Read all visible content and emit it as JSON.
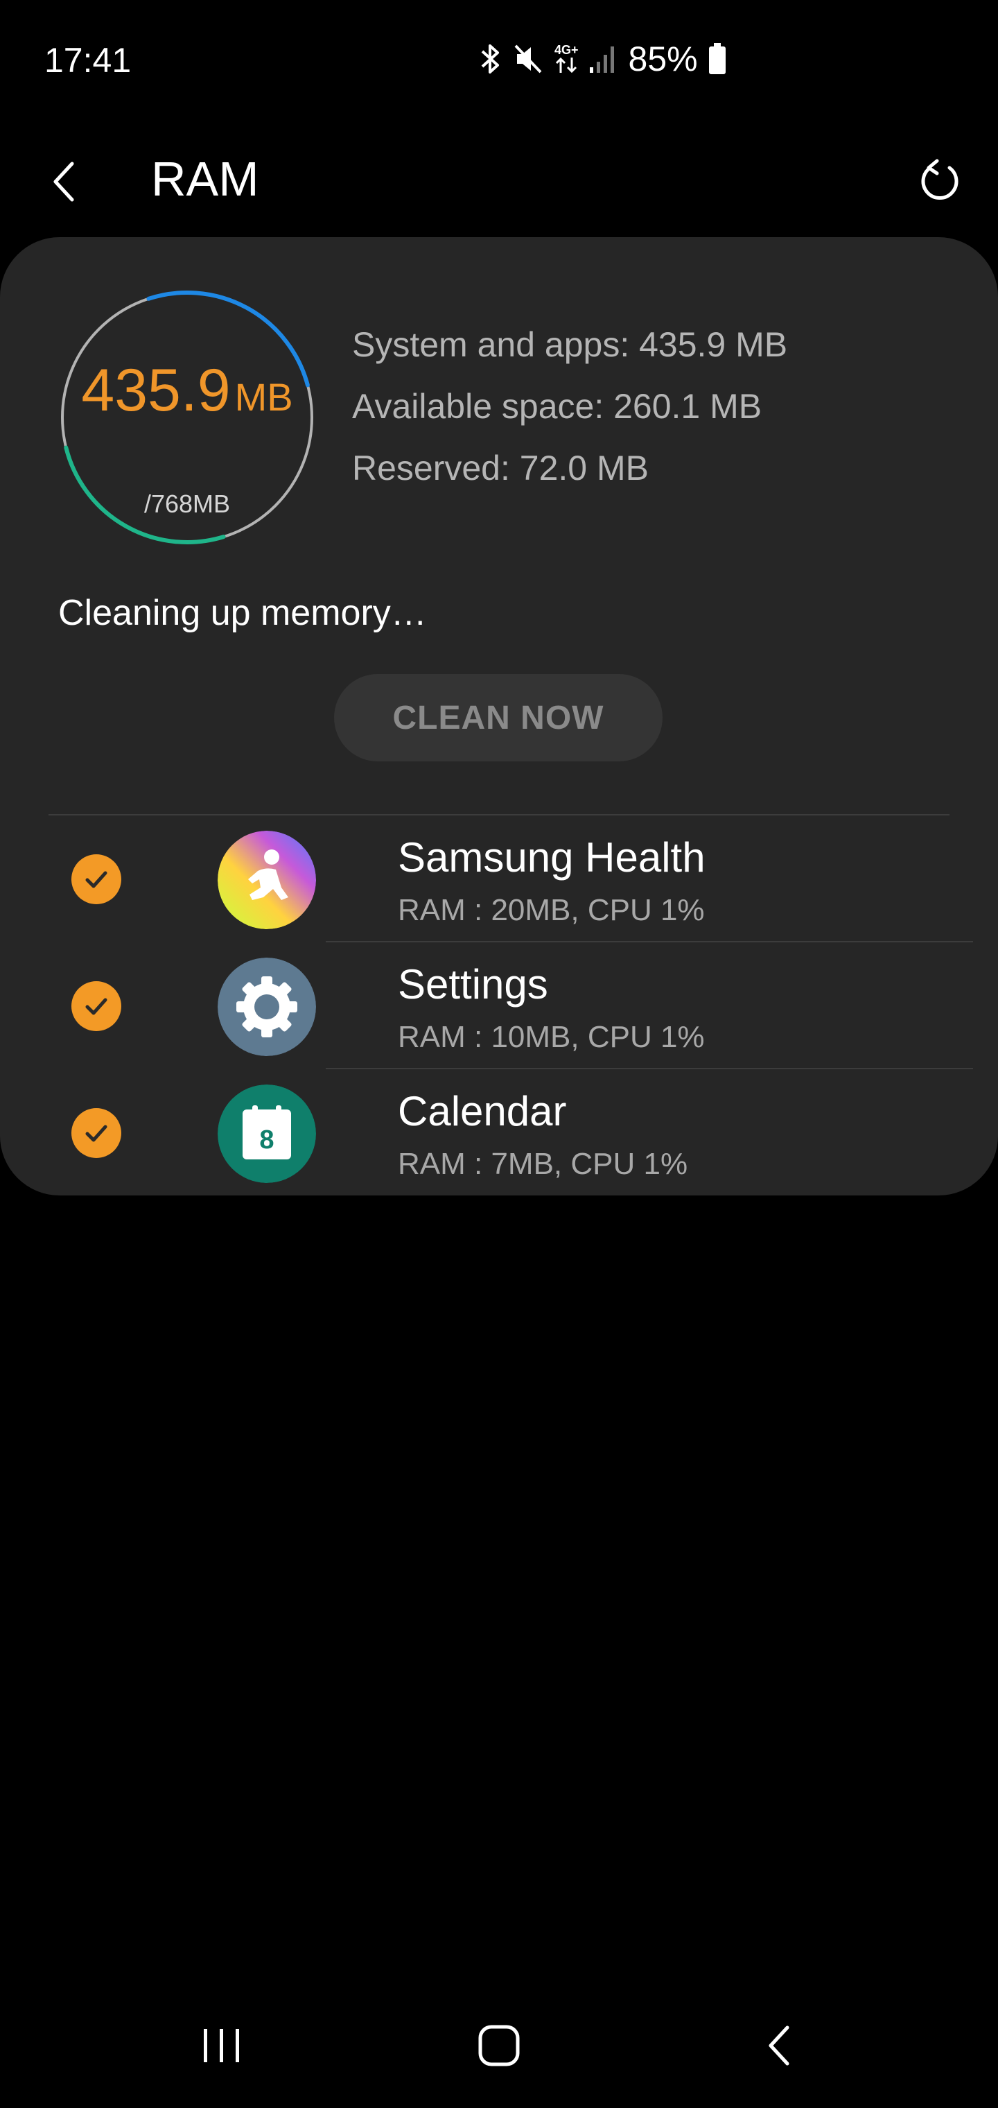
{
  "status_bar": {
    "time": "17:41",
    "network": "4G+",
    "battery": "85%"
  },
  "header": {
    "title": "RAM"
  },
  "memory": {
    "used_value": "435.9",
    "used_unit": "MB",
    "total": "/768MB",
    "used_fraction": 0.568,
    "stats": {
      "system_apps": "System and apps: 435.9 MB",
      "available": "Available space: 260.1 MB",
      "reserved": "Reserved: 72.0 MB"
    },
    "status_message": "Cleaning up memory…",
    "clean_button_label": "CLEAN NOW"
  },
  "apps": [
    {
      "name": "Samsung Health",
      "usage": "RAM : 20MB, CPU 1%",
      "checked": true,
      "icon": "samsung-health-icon"
    },
    {
      "name": "Settings",
      "usage": "RAM : 10MB, CPU 1%",
      "checked": true,
      "icon": "settings-gear-icon"
    },
    {
      "name": "Calendar",
      "usage": "RAM : 7MB, CPU 1%",
      "checked": true,
      "icon": "calendar-icon",
      "icon_day": "8"
    }
  ],
  "colors": {
    "accent_orange": "#f0962a",
    "gauge_blue": "#1e88e5",
    "gauge_green": "#1fb58a",
    "card_bg": "#262626"
  }
}
